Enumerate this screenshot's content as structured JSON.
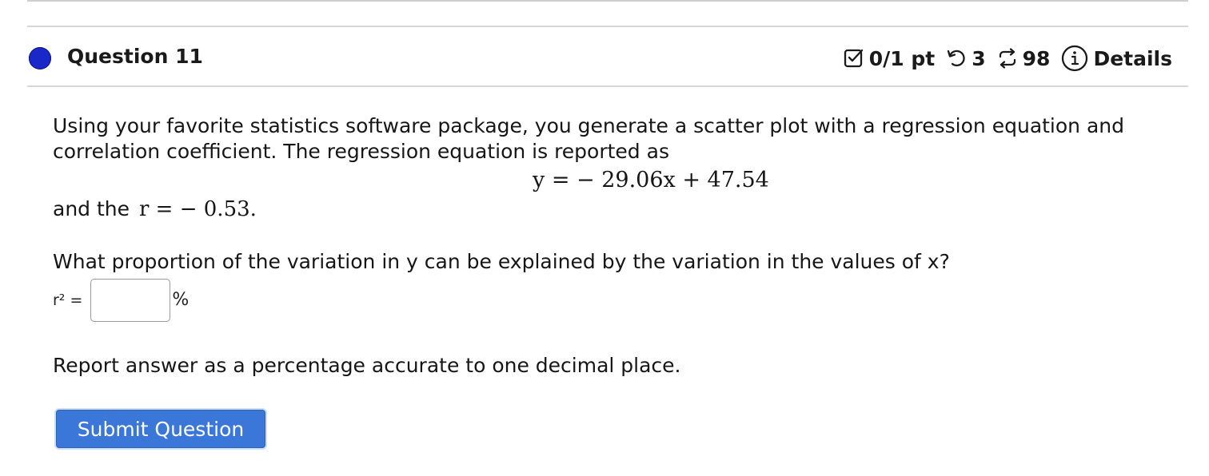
{
  "question": {
    "title": "Question 11",
    "score": "0/1 pt",
    "attempts": "3",
    "retries": "98",
    "details_label": "Details",
    "status_color": "#1a27c9"
  },
  "body": {
    "intro": "Using your favorite statistics software package, you generate a scatter plot with a regression equation and correlation coefficient. The regression equation is reported as",
    "equation": "y = − 29.06x + 47.54",
    "r_prefix": "and the",
    "r_expression": "r =  − 0.53.",
    "prompt": "What proportion of the variation in y can be explained by the variation in the values of x?",
    "answer_label": "r² =",
    "answer_value": "",
    "answer_unit": "%",
    "report_note": "Report answer as a percentage accurate to one decimal place."
  },
  "actions": {
    "submit_label": "Submit Question",
    "submit_color": "#3a77d8"
  },
  "icons": {
    "score": "checkbox-icon",
    "attempts": "undo-icon",
    "retries": "repeat-icon",
    "details": "info-icon"
  }
}
